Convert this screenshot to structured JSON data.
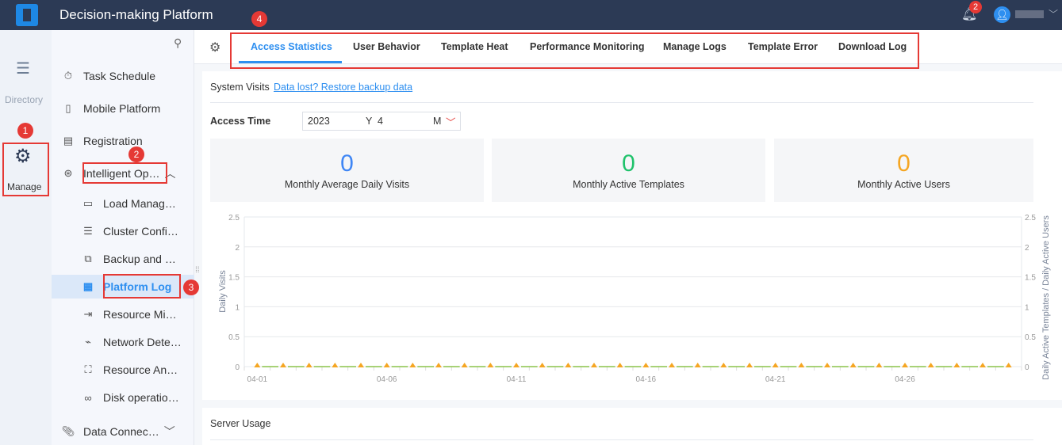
{
  "header": {
    "title": "Decision-making Platform",
    "notification_count": "2"
  },
  "rail": {
    "directory": "Directory",
    "manage": "Manage"
  },
  "nav": {
    "items": [
      {
        "label": "Task Schedule",
        "icon": "stopwatch-icon"
      },
      {
        "label": "Mobile Platform",
        "icon": "mobile-icon"
      },
      {
        "label": "Registration",
        "icon": "registration-icon"
      },
      {
        "label": "Intelligent Op…",
        "icon": "ops-icon"
      }
    ],
    "sub_items": [
      {
        "label": "Load Manag…"
      },
      {
        "label": "Cluster Confi…"
      },
      {
        "label": "Backup and …"
      },
      {
        "label": "Platform Log"
      },
      {
        "label": "Resource Mi…"
      },
      {
        "label": "Network Dete…"
      },
      {
        "label": "Resource An…"
      },
      {
        "label": "Disk operatio…"
      }
    ],
    "data_connections": "Data Connec…"
  },
  "annotations": [
    "1",
    "2",
    "3",
    "4"
  ],
  "tabs": [
    "Access Statistics",
    "User Behavior",
    "Template Heat",
    "Performance Monitoring",
    "Manage Logs",
    "Template Error",
    "Download Log"
  ],
  "system_visits": {
    "label": "System Visits",
    "restore_link": "Data lost? Restore backup data"
  },
  "access_time": {
    "label": "Access Time",
    "year": "2023",
    "year_unit": "Y",
    "month": "4",
    "month_unit": "M"
  },
  "stats": [
    {
      "value": "0",
      "label": "Monthly Average Daily Visits",
      "color": "#3f86f5"
    },
    {
      "value": "0",
      "label": "Monthly Active Templates",
      "color": "#1fc26b"
    },
    {
      "value": "0",
      "label": "Monthly Active Users",
      "color": "#f5a623"
    }
  ],
  "server_usage": "Server Usage",
  "chart_data": {
    "type": "line",
    "ylabel": "Daily Visits",
    "ylabel_right": "Daily Active Templates / Daily Active Users",
    "ylim": [
      0,
      2.5
    ],
    "yticks": [
      "0",
      "0.5",
      "1",
      "1.5",
      "2",
      "2.5"
    ],
    "xticks": [
      "04-01",
      "04-06",
      "04-11",
      "04-16",
      "04-21",
      "04-26"
    ],
    "x_days": 30,
    "series": [
      {
        "name": "Daily Visits",
        "color": "#f5a623",
        "values": [
          0,
          0,
          0,
          0,
          0,
          0,
          0,
          0,
          0,
          0,
          0,
          0,
          0,
          0,
          0,
          0,
          0,
          0,
          0,
          0,
          0,
          0,
          0,
          0,
          0,
          0,
          0,
          0,
          0,
          0
        ]
      },
      {
        "name": "Daily Active Templates",
        "color": "#8bc34a",
        "values": [
          0,
          0,
          0,
          0,
          0,
          0,
          0,
          0,
          0,
          0,
          0,
          0,
          0,
          0,
          0,
          0,
          0,
          0,
          0,
          0,
          0,
          0,
          0,
          0,
          0,
          0,
          0,
          0,
          0,
          0
        ]
      }
    ]
  }
}
